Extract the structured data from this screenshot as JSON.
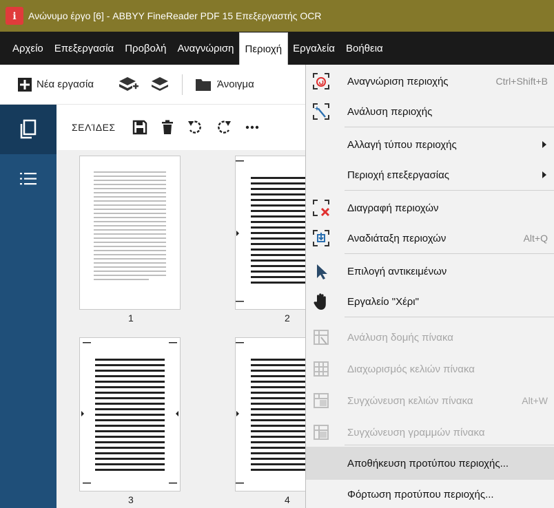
{
  "window": {
    "title": "Ανώνυμο έργο [6] - ABBYY FineReader PDF 15 Επεξεργαστής OCR"
  },
  "menubar": {
    "items": [
      "Αρχείο",
      "Επεξεργασία",
      "Προβολή",
      "Αναγνώριση",
      "Περιοχή",
      "Εργαλεία",
      "Βοήθεια"
    ],
    "active_index": 4
  },
  "toolbar": {
    "new_task_label": "Νέα εργασία",
    "open_label": "Άνοιγμα"
  },
  "pages_panel": {
    "title": "ΣΕΛΊΔΕΣ",
    "page_numbers": [
      "1",
      "2",
      "3",
      "4"
    ]
  },
  "dropdown": {
    "items": [
      {
        "label": "Αναγνώριση περιοχής",
        "shortcut": "Ctrl+Shift+B",
        "icon": "recognize-area-icon",
        "disabled": false
      },
      {
        "label": "Ανάλυση περιοχής",
        "shortcut": "",
        "icon": "analyze-area-icon",
        "disabled": false
      },
      {
        "label": "Αλλαγή τύπου περιοχής",
        "shortcut": "",
        "icon": "",
        "submenu": true,
        "disabled": false
      },
      {
        "label": "Περιοχή επεξεργασίας",
        "shortcut": "",
        "icon": "",
        "submenu": true,
        "disabled": false
      },
      {
        "label": "Διαγραφή περιοχών",
        "shortcut": "",
        "icon": "delete-areas-icon",
        "disabled": false
      },
      {
        "label": "Αναδιάταξη περιοχών",
        "shortcut": "Alt+Q",
        "icon": "reorder-areas-icon",
        "disabled": false
      },
      {
        "label": "Επιλογή αντικειμένων",
        "shortcut": "",
        "icon": "select-objects-icon",
        "disabled": false
      },
      {
        "label": "Εργαλείο \"Χέρι\"",
        "shortcut": "",
        "icon": "hand-tool-icon",
        "disabled": false
      },
      {
        "label": "Ανάλυση δομής πίνακα",
        "shortcut": "",
        "icon": "analyze-table-icon",
        "disabled": true
      },
      {
        "label": "Διαχωρισμός κελιών πίνακα",
        "shortcut": "",
        "icon": "split-cells-icon",
        "disabled": true
      },
      {
        "label": "Συγχώνευση κελιών πίνακα",
        "shortcut": "Alt+W",
        "icon": "merge-cells-icon",
        "disabled": true
      },
      {
        "label": "Συγχώνευση γραμμών πίνακα",
        "shortcut": "",
        "icon": "merge-rows-icon",
        "disabled": true
      },
      {
        "label": "Αποθήκευση προτύπου περιοχής...",
        "shortcut": "",
        "icon": "",
        "disabled": false,
        "highlighted": true
      },
      {
        "label": "Φόρτωση προτύπου περιοχής...",
        "shortcut": "",
        "icon": "",
        "disabled": false
      }
    ]
  },
  "colors": {
    "titlebar": "#84782a",
    "menubar": "#1a1a1a",
    "leftbar": "#1f4f79",
    "delete_red": "#e03030"
  }
}
